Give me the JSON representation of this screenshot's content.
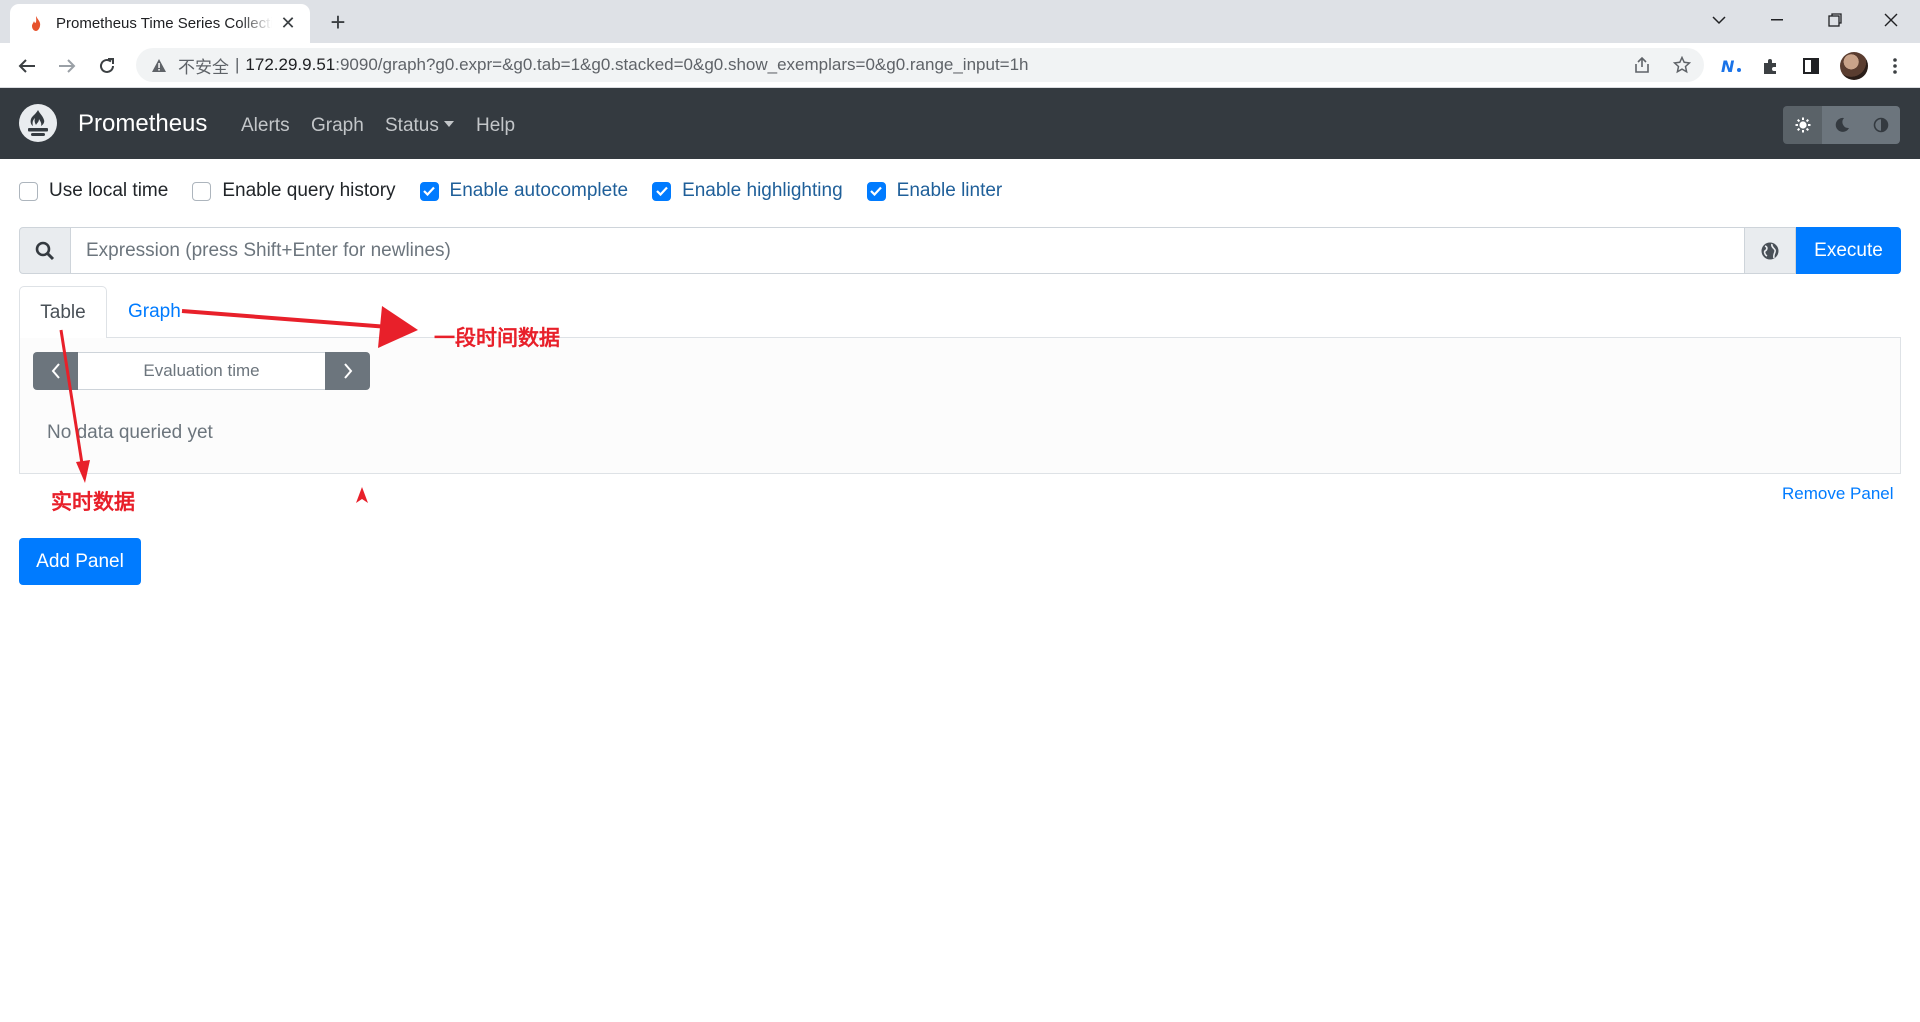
{
  "browser": {
    "tab_title": "Prometheus Time Series Collection and Processing Server",
    "new_tab": "+",
    "close": "✕",
    "insecure_label": "不安全",
    "separator": "|",
    "url_host": "172.29.9.51",
    "url_rest": ":9090/graph?g0.expr=&g0.tab=1&g0.stacked=0&g0.show_exemplars=0&g0.range_input=1h"
  },
  "navbar": {
    "brand": "Prometheus",
    "links": {
      "alerts": "Alerts",
      "graph": "Graph",
      "status": "Status",
      "help": "Help"
    }
  },
  "options": {
    "use_local_time": {
      "label": "Use local time",
      "checked": false
    },
    "query_history": {
      "label": "Enable query history",
      "checked": false
    },
    "autocomplete": {
      "label": "Enable autocomplete",
      "checked": true
    },
    "highlighting": {
      "label": "Enable highlighting",
      "checked": true
    },
    "linter": {
      "label": "Enable linter",
      "checked": true
    }
  },
  "expression": {
    "placeholder": "Expression (press Shift+Enter for newlines)",
    "execute_label": "Execute"
  },
  "panel": {
    "tabs": {
      "table": "Table",
      "graph": "Graph"
    },
    "evaluation_placeholder": "Evaluation time",
    "no_data": "No data queried yet",
    "remove_label": "Remove Panel"
  },
  "add_panel_label": "Add Panel",
  "annotations": {
    "graph_note": "一段时间数据",
    "table_note": "实时数据"
  },
  "colors": {
    "navbar": "#343a40",
    "primary": "#007bff",
    "annotation": "#e8202a"
  }
}
